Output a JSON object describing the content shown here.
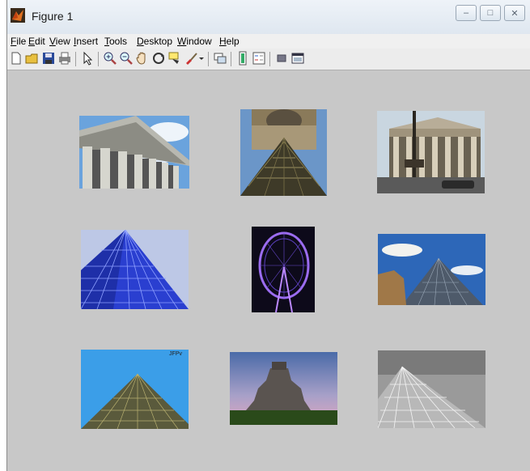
{
  "window": {
    "title": "Figure 1",
    "controls": {
      "minimize": "–",
      "maximize": "□",
      "close": "✕"
    }
  },
  "menu": {
    "items": [
      {
        "underline": "F",
        "rest": "ile"
      },
      {
        "underline": "E",
        "rest": "dit"
      },
      {
        "underline": "V",
        "rest": "iew"
      },
      {
        "underline": "I",
        "rest": "nsert"
      },
      {
        "underline": "T",
        "rest": "ools"
      },
      {
        "underline": "D",
        "rest": "esktop"
      },
      {
        "underline": "W",
        "rest": "indow"
      },
      {
        "underline": "H",
        "rest": "elp"
      }
    ]
  },
  "toolbar": {
    "buttons": [
      "new-figure-icon",
      "open-file-icon",
      "save-icon",
      "print-icon",
      "edit-plot-arrow-icon",
      "zoom-in-icon",
      "zoom-out-icon",
      "pan-hand-icon",
      "rotate-3d-icon",
      "data-cursor-icon",
      "brush-icon",
      "link-plot-icon",
      "colorbar-icon",
      "legend-icon",
      "hide-plot-tools-icon",
      "show-plot-tools-icon"
    ]
  },
  "figure": {
    "images": [
      {
        "subject": "classical-temple-columns",
        "caption": ""
      },
      {
        "subject": "louvre-pyramid-palace",
        "caption": ""
      },
      {
        "subject": "pantheon-facade",
        "caption": ""
      },
      {
        "subject": "blue-glass-pyramid",
        "caption": ""
      },
      {
        "subject": "ferris-wheel-night",
        "caption": ""
      },
      {
        "subject": "louvre-pyramid-sky",
        "caption": ""
      },
      {
        "subject": "pyramid-blue-sky",
        "caption": "JFPv"
      },
      {
        "subject": "mayan-pyramid-sunset",
        "caption": ""
      },
      {
        "subject": "glass-pyramid-closeup",
        "caption": ""
      }
    ]
  }
}
